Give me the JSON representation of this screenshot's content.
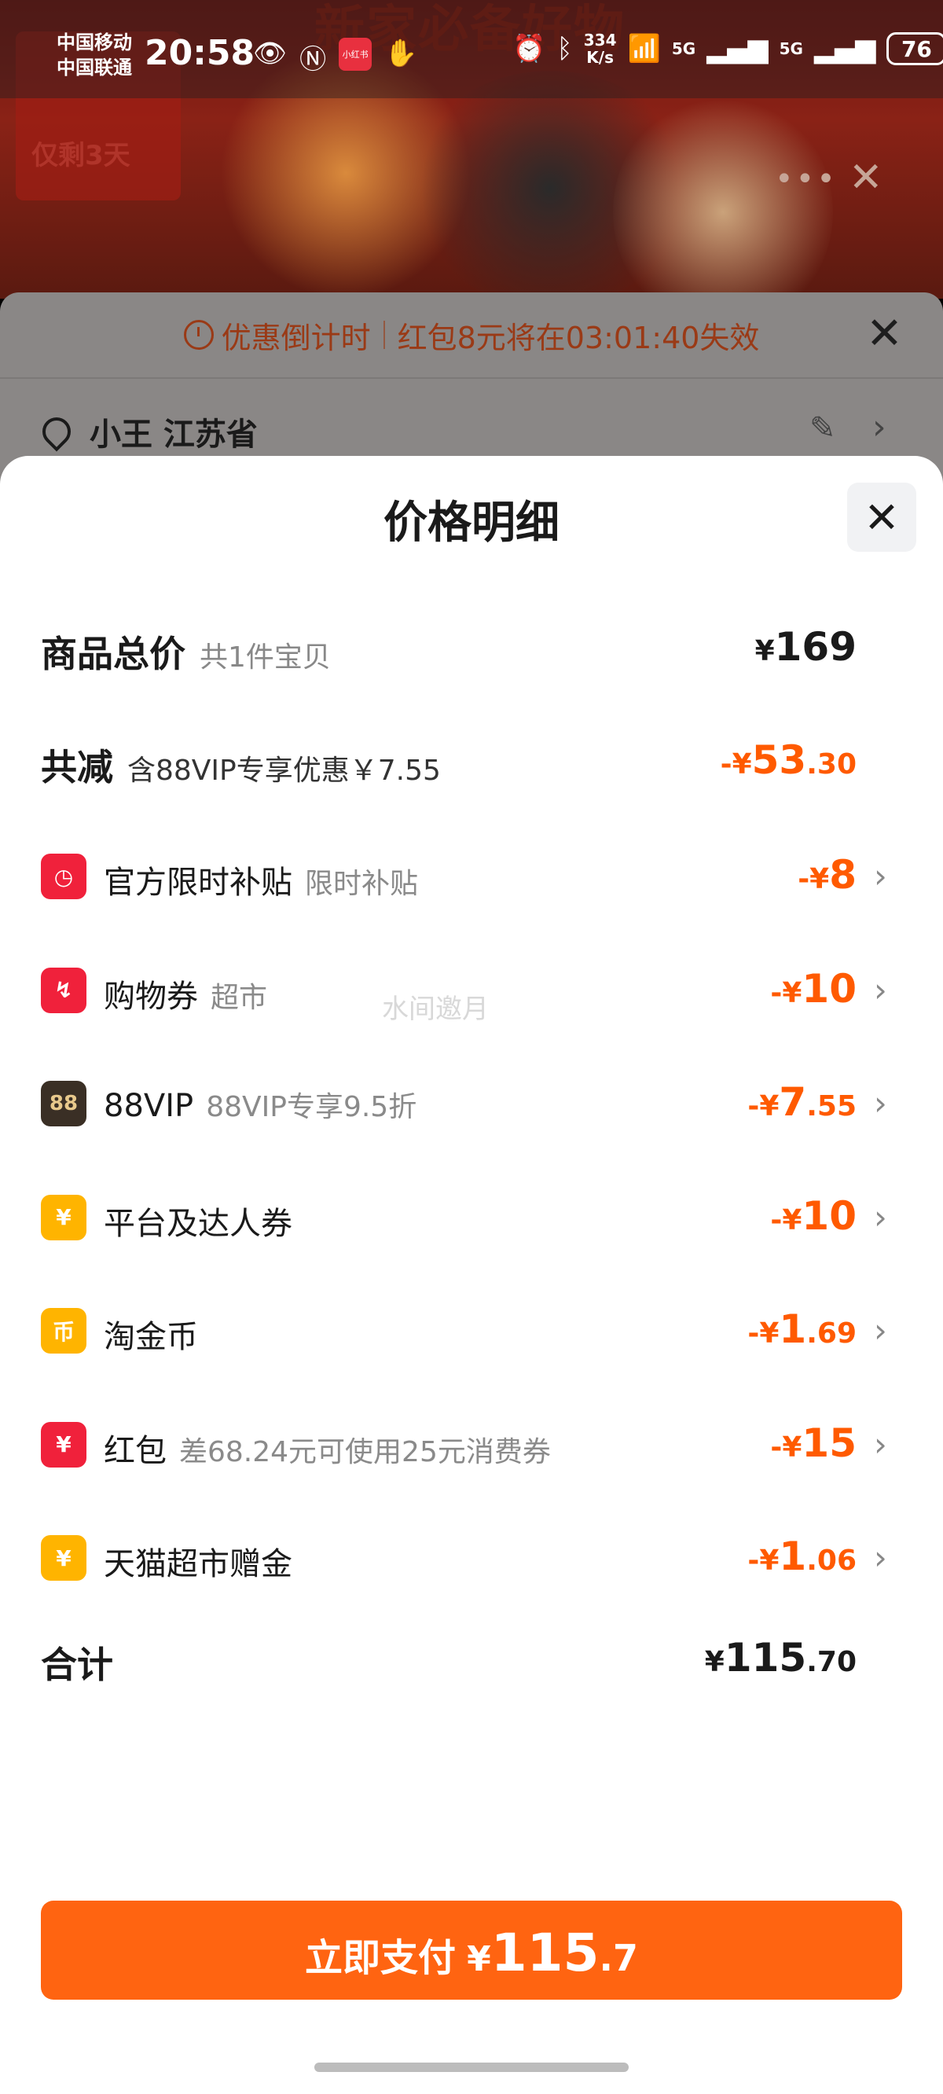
{
  "status_bar": {
    "carrier_1": "中国移动",
    "carrier_2": "中国联通",
    "time": "20:58",
    "app_badge": "小红书",
    "net_speed_value": "334",
    "net_speed_unit": "K/s",
    "signal_1": "5G",
    "signal_2": "5G",
    "battery": "76"
  },
  "banner": {
    "title": "新家必备好物",
    "badge_text": "仅剩3天"
  },
  "countdown": {
    "label": "优惠倒计时",
    "message": "红包8元将在03:01:40失效"
  },
  "address": {
    "text": "小王 江苏省"
  },
  "sheet": {
    "title": "价格明细",
    "goods_total": {
      "label": "商品总价",
      "sub": "共1件宝贝",
      "currency": "¥",
      "value": "169"
    },
    "total_reduce": {
      "label": "共减",
      "sub": "含88VIP专享优惠￥7.55",
      "sign": "-¥",
      "value": "53",
      "decimal": ".30"
    },
    "items": [
      {
        "name": "官方限时补贴",
        "hint": "限时补贴",
        "sign": "-¥",
        "value": "8",
        "decimal": "",
        "icon": "clock-icon",
        "icon_color": "#f0213b"
      },
      {
        "name": "购物券",
        "hint": "超市",
        "sign": "-¥",
        "value": "10",
        "decimal": "",
        "icon": "coupon-icon",
        "icon_color": "#f0213b"
      },
      {
        "name": "88VIP",
        "hint": "88VIP专享9.5折",
        "sign": "-¥",
        "value": "7",
        "decimal": ".55",
        "icon": "vip-icon",
        "icon_color": "#3a2f25"
      },
      {
        "name": "平台及达人券",
        "hint": "",
        "sign": "-¥",
        "value": "10",
        "decimal": "",
        "icon": "ticket-icon",
        "icon_color": "#ffb400"
      },
      {
        "name": "淘金币",
        "hint": "",
        "sign": "-¥",
        "value": "1",
        "decimal": ".69",
        "icon": "coin-icon",
        "icon_color": "#ffb400"
      },
      {
        "name": "红包",
        "hint": "差68.24元可使用25元消费券",
        "sign": "-¥",
        "value": "15",
        "decimal": "",
        "icon": "red-packet-icon",
        "icon_color": "#f0213b"
      },
      {
        "name": "天猫超市赠金",
        "hint": "",
        "sign": "-¥",
        "value": "1",
        "decimal": ".06",
        "icon": "gift-money-icon",
        "icon_color": "#ffb400"
      }
    ],
    "total": {
      "label": "合计",
      "currency": "¥",
      "value": "115",
      "decimal": ".70"
    },
    "watermark": "水间邀月"
  },
  "pay_button": {
    "label": "立即支付",
    "currency": "¥",
    "value": "115",
    "decimal": ".7"
  },
  "colors": {
    "accent": "#ff6411",
    "discount": "#ff5a00",
    "red_icon": "#f0213b",
    "yellow_icon": "#ffb400"
  }
}
